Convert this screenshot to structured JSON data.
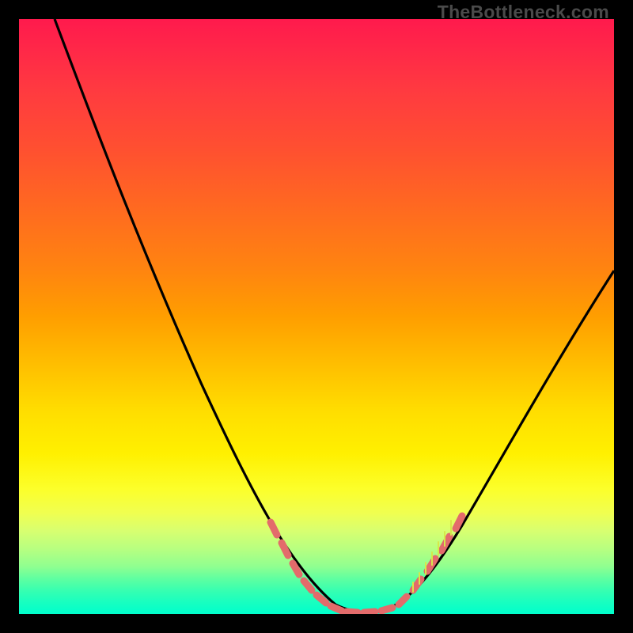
{
  "watermark": "TheBottleneck.com",
  "chart_data": {
    "type": "line",
    "title": "",
    "xlabel": "",
    "ylabel": "",
    "xlim": [
      0,
      100
    ],
    "ylim": [
      0,
      100
    ],
    "series": [
      {
        "name": "main-curve",
        "x": [
          6,
          10,
          15,
          20,
          25,
          30,
          35,
          40,
          45,
          48,
          50,
          52,
          54,
          56,
          58,
          60,
          62,
          64,
          66,
          70,
          75,
          80,
          85,
          90,
          95,
          100
        ],
        "y": [
          100,
          90,
          78,
          66,
          54,
          42,
          31,
          21,
          12,
          7,
          4,
          2,
          1,
          0,
          0,
          0,
          1,
          2,
          4,
          8,
          14,
          22,
          31,
          40,
          49,
          58
        ],
        "color": "#000000"
      },
      {
        "name": "highlight-markers",
        "x": [
          44,
          46,
          48,
          50,
          52,
          54,
          56,
          58,
          60,
          62,
          64,
          66,
          68,
          70
        ],
        "y": [
          14,
          10,
          7,
          4,
          2,
          1,
          0,
          0,
          0,
          1,
          2,
          4,
          6,
          8
        ],
        "color": "#e36b6b"
      }
    ],
    "annotations": []
  }
}
